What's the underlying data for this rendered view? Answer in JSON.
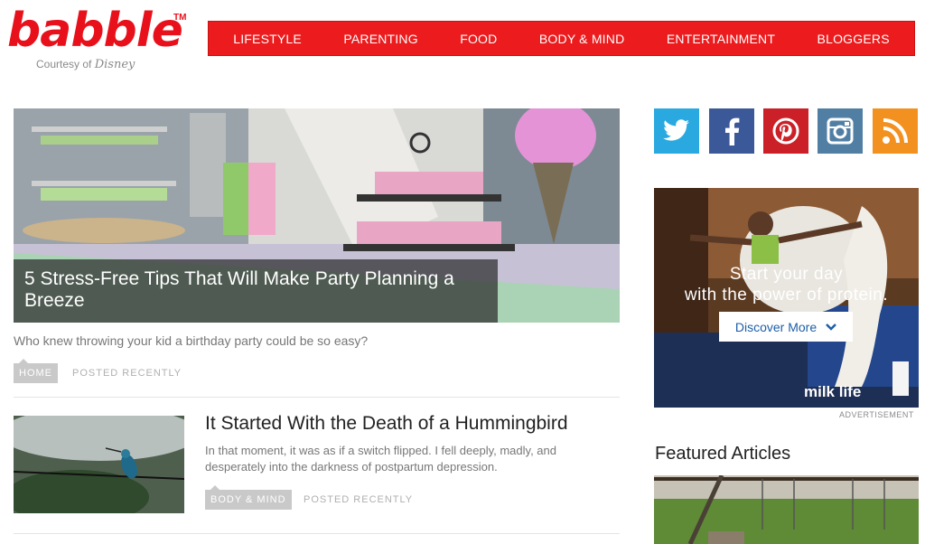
{
  "logo": {
    "word": "babble",
    "tm": "TM",
    "courtesy": "Courtesy of",
    "disney": "Disney"
  },
  "nav": {
    "items": [
      "LIFESTYLE",
      "PARENTING",
      "FOOD",
      "BODY & MIND",
      "ENTERTAINMENT",
      "BLOGGERS"
    ]
  },
  "hero": {
    "title": "5 Stress-Free Tips That Will Make Party Planning a Breeze",
    "desc": "Who knew throwing your kid a birthday party could be so easy?",
    "tag": "HOME",
    "posted": "POSTED RECENTLY"
  },
  "article2": {
    "title": "It Started With the Death of a Hummingbird",
    "desc": "In that moment, it was as if a switch flipped. I fell deeply, madly, and desperately into the darkness of postpartum depression.",
    "tag": "BODY & MIND",
    "posted": "POSTED RECENTLY"
  },
  "social": {
    "icons": [
      "twitter-icon",
      "facebook-icon",
      "pinterest-icon",
      "instagram-icon",
      "rss-icon"
    ],
    "colors": {
      "twitter": "#2aa9e0",
      "facebook": "#3b5998",
      "pinterest": "#cb2027",
      "instagram": "#517fa4",
      "rss": "#f39120"
    }
  },
  "ad": {
    "headline_line1": "Start your day",
    "headline_line2": "with the power of protein.",
    "button": "Discover More",
    "brand": "milk life",
    "label": "ADVERTISEMENT"
  },
  "featured": {
    "title": "Featured Articles"
  },
  "colors": {
    "brand_red": "#ec1b1d",
    "tag_gray": "#c9c9c9"
  }
}
